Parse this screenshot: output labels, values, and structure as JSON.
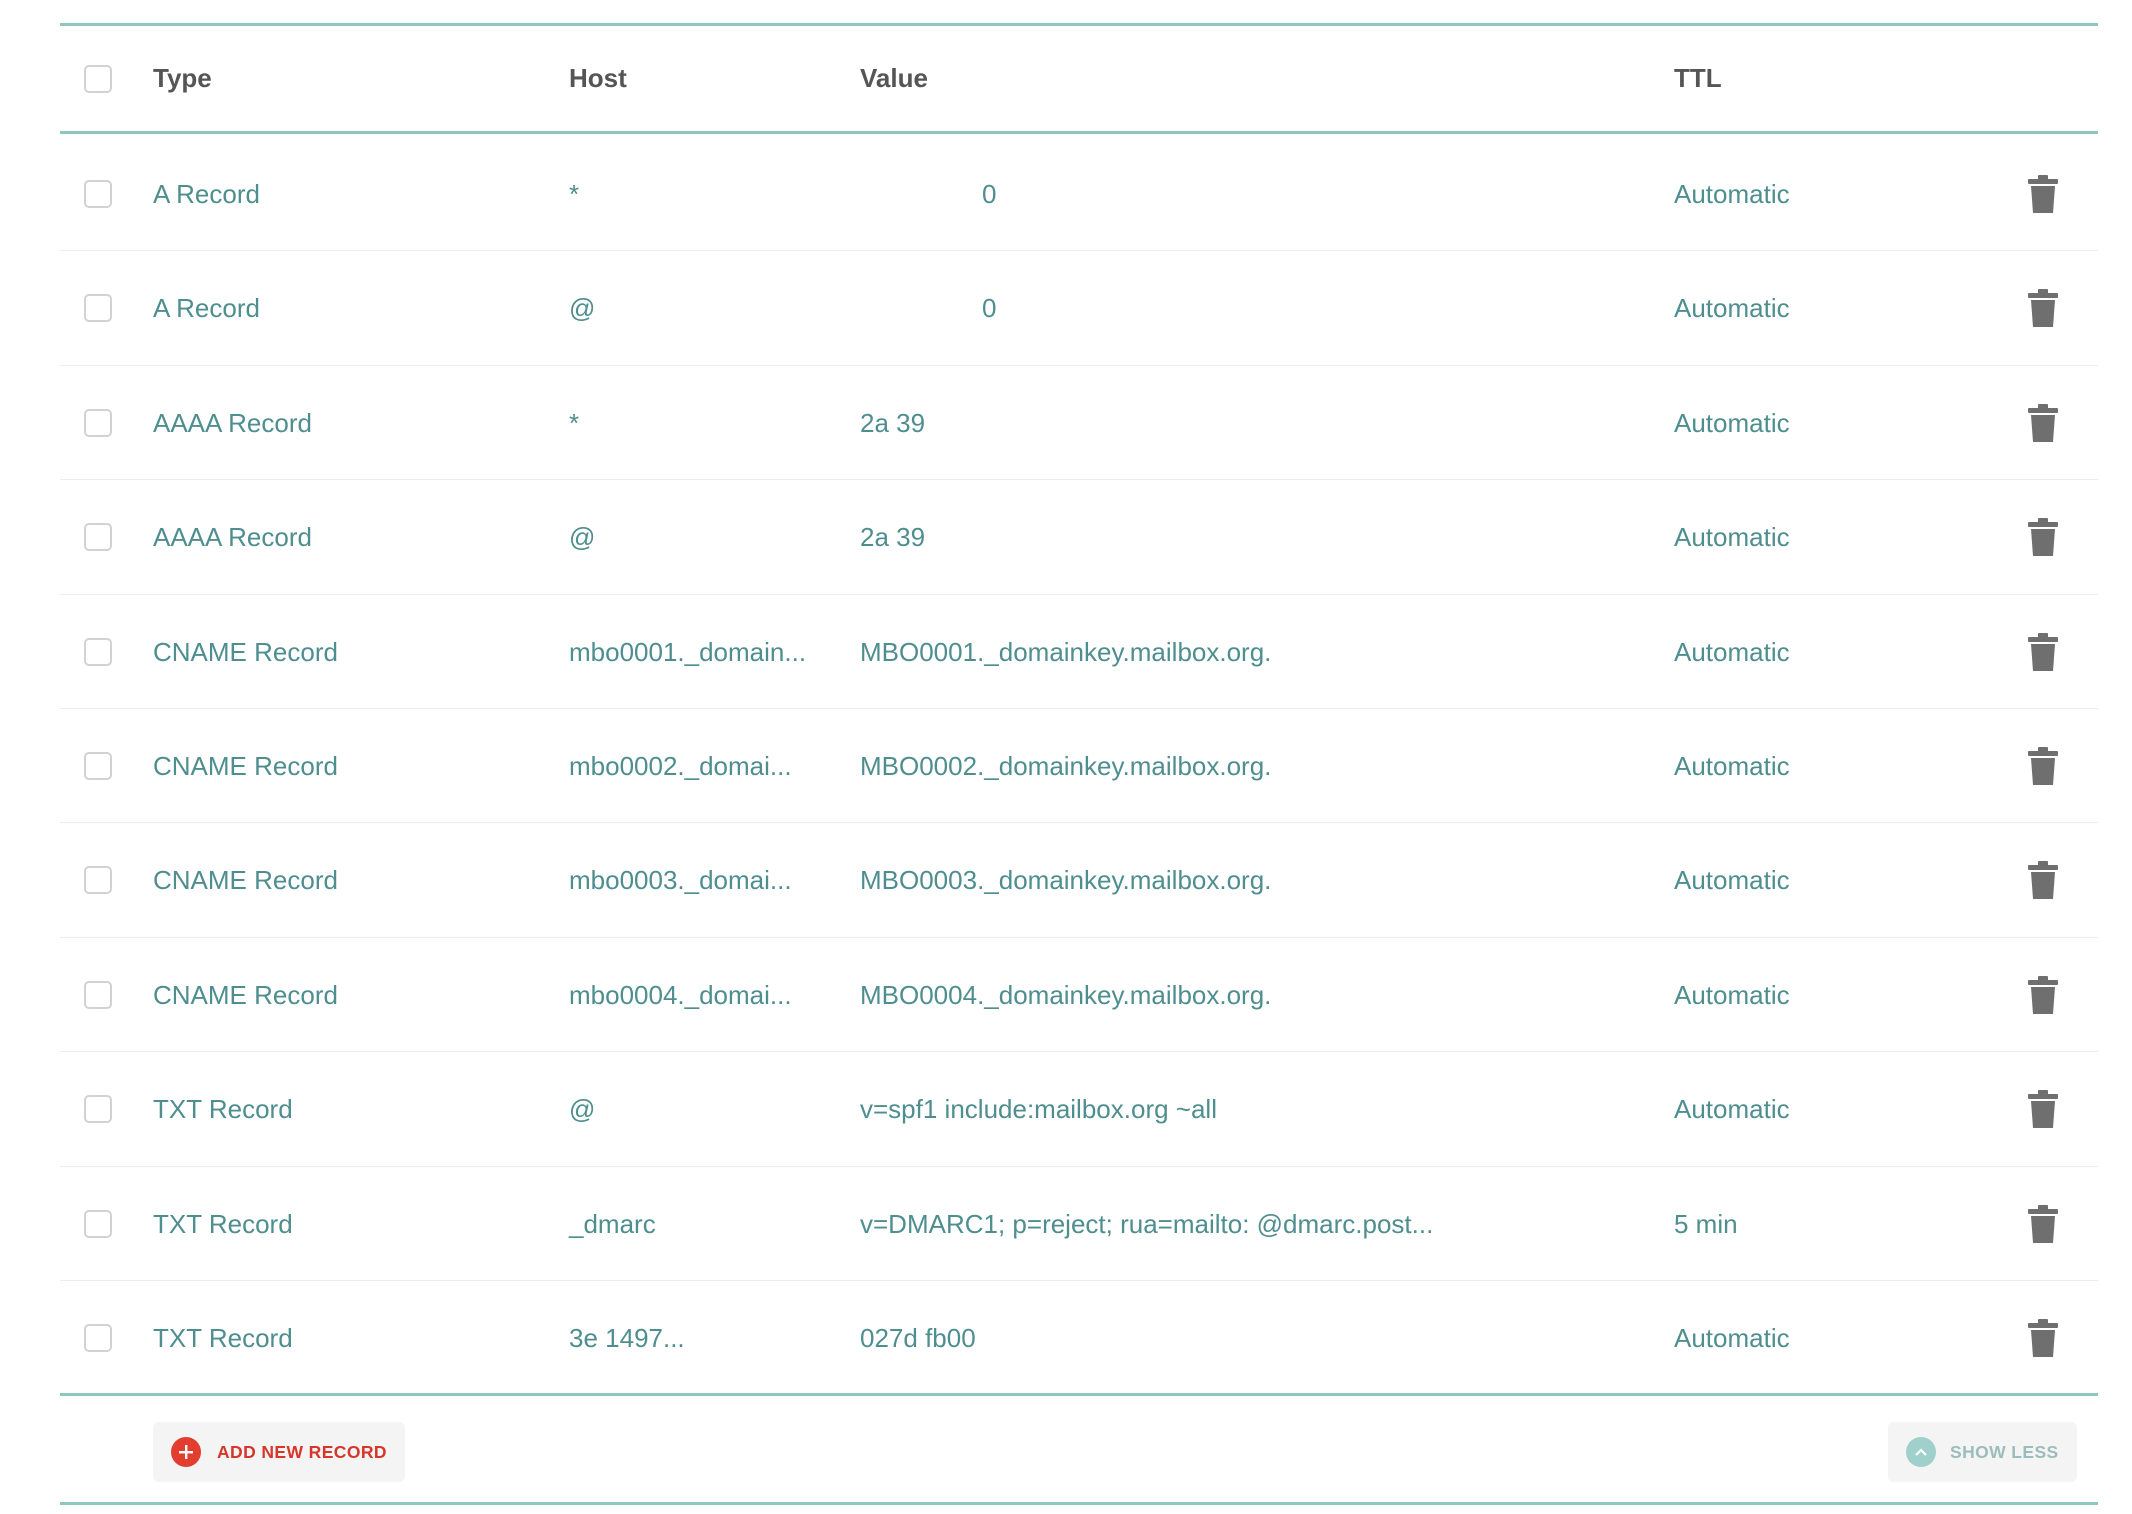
{
  "header": {
    "type": "Type",
    "host": "Host",
    "value": "Value",
    "ttl": "TTL"
  },
  "records": [
    {
      "type": "A Record",
      "host": "*",
      "value": "0",
      "ttl": "Automatic"
    },
    {
      "type": "A Record",
      "host": "@",
      "value": "0",
      "ttl": "Automatic"
    },
    {
      "type": "AAAA Record",
      "host": "*",
      "value": "2a 39",
      "ttl": "Automatic"
    },
    {
      "type": "AAAA Record",
      "host": "@",
      "value": "2a 39",
      "ttl": "Automatic"
    },
    {
      "type": "CNAME Record",
      "host": "mbo0001._domain...",
      "value": "MBO0001._domainkey.mailbox.org.",
      "ttl": "Automatic"
    },
    {
      "type": "CNAME Record",
      "host": "mbo0002._domai...",
      "value": "MBO0002._domainkey.mailbox.org.",
      "ttl": "Automatic"
    },
    {
      "type": "CNAME Record",
      "host": "mbo0003._domai...",
      "value": "MBO0003._domainkey.mailbox.org.",
      "ttl": "Automatic"
    },
    {
      "type": "CNAME Record",
      "host": "mbo0004._domai...",
      "value": "MBO0004._domainkey.mailbox.org.",
      "ttl": "Automatic"
    },
    {
      "type": "TXT Record",
      "host": "@",
      "value": "v=spf1 include:mailbox.org ~all",
      "ttl": "Automatic"
    },
    {
      "type": "TXT Record",
      "host": "_dmarc",
      "value": "v=DMARC1; p=reject; rua=mailto: @dmarc.post...",
      "ttl": "5 min"
    },
    {
      "type": "TXT Record",
      "host": "3e 1497...",
      "value": "027d fb00",
      "ttl": "Automatic"
    }
  ],
  "footer": {
    "add_label": "ADD NEW RECORD",
    "show_less_label": "SHOW LESS"
  },
  "colors": {
    "accent_teal": "#8fc6c0",
    "row_text": "#4f8e8f",
    "add_red": "#e23d2f",
    "trash_gray": "#6f6f6f"
  },
  "icons": {
    "delete": "trash-icon",
    "add": "plus-circle-icon",
    "collapse": "chevron-up-icon"
  }
}
